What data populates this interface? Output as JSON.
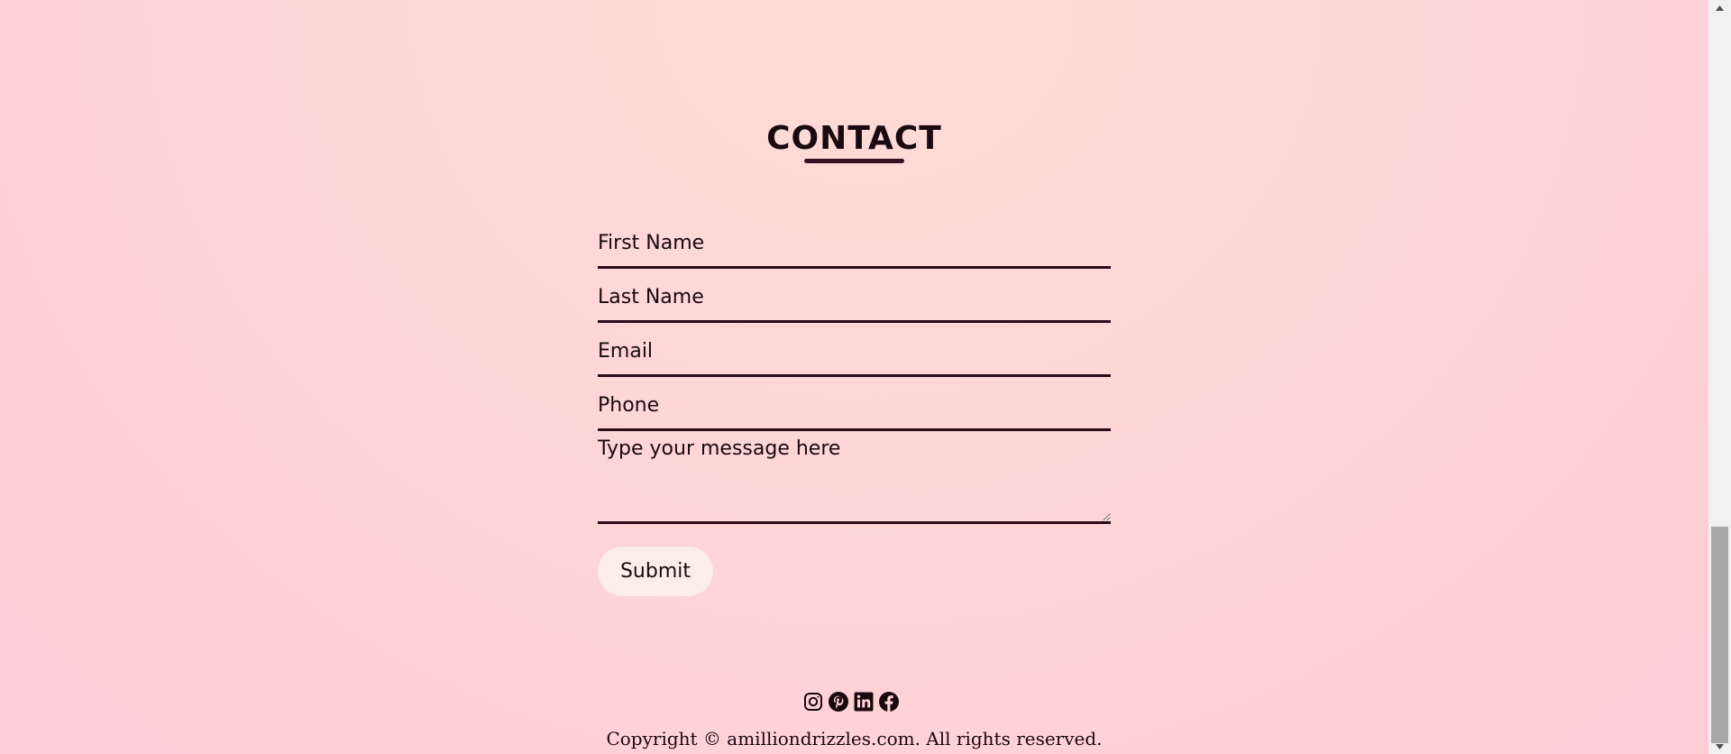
{
  "contact": {
    "title": "CONTACT",
    "fields": {
      "first_name_placeholder": "First Name",
      "last_name_placeholder": "Last Name",
      "email_placeholder": "Email",
      "phone_placeholder": "Phone",
      "message_placeholder": "Type your message here"
    },
    "submit_label": "Submit"
  },
  "footer": {
    "social_icons": [
      "instagram-icon",
      "pinterest-icon",
      "linkedin-icon",
      "facebook-icon"
    ],
    "copyright": "Copyright © amilliondrizzles.com. All rights reserved."
  },
  "colors": {
    "accent": "#3b0f22",
    "button_bg": "#fbeee6",
    "background": "#fed4d6"
  }
}
